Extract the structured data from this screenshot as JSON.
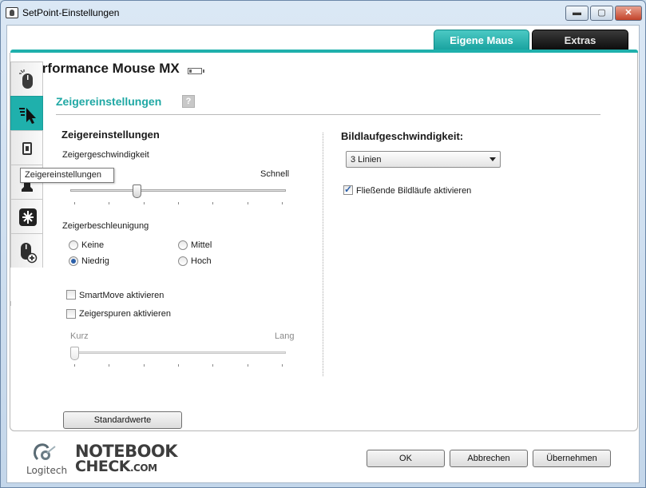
{
  "window": {
    "title": "SetPoint-Einstellungen",
    "controls": {
      "minimize": "▬",
      "maximize": "▢",
      "close": "✕"
    }
  },
  "tabs": [
    {
      "label": "Eigene Maus",
      "active": true
    },
    {
      "label": "Extras",
      "active": false
    }
  ],
  "device": {
    "name": "Performance Mouse MX"
  },
  "side_tabs": [
    {
      "icon": "mouse-buttons-icon",
      "active": false
    },
    {
      "icon": "pointer-settings-icon",
      "active": true
    },
    {
      "icon": "device-icon",
      "active": false
    },
    {
      "icon": "chess-rook-icon",
      "active": false
    },
    {
      "icon": "snowflake-icon",
      "active": false
    },
    {
      "icon": "mouse-add-icon",
      "active": false
    }
  ],
  "tooltip": "Zeigereinstellungen",
  "section": {
    "title": "Zeigereinstellungen",
    "help": "?"
  },
  "pointer": {
    "group_title": "Zeigereinstellungen",
    "speed_label": "Zeigergeschwindigkeit",
    "speed_max_label": "Schnell",
    "speed_value": 0.3,
    "accel_label": "Zeigerbeschleunigung",
    "accel_options": [
      {
        "label": "Keine",
        "checked": false
      },
      {
        "label": "Mittel",
        "checked": false
      },
      {
        "label": "Niedrig",
        "checked": true
      },
      {
        "label": "Hoch",
        "checked": false
      }
    ],
    "smartmove": {
      "label": "SmartMove aktivieren",
      "checked": false
    },
    "trails": {
      "label": "Zeigerspuren aktivieren",
      "checked": false
    },
    "trail_min_label": "Kurz",
    "trail_max_label": "Lang",
    "trail_value": 0.0
  },
  "scroll": {
    "group_title": "Bildlaufgeschwindigkeit:",
    "selected": "3 Linien",
    "smooth": {
      "label": "Fließende Bildläufe aktivieren",
      "checked": true
    }
  },
  "buttons": {
    "defaults": "Standardwerte",
    "ok": "OK",
    "cancel": "Abbrechen",
    "apply": "Übernehmen"
  },
  "footer": {
    "logitech": "Logitech",
    "notebook": "NOTEBOOK",
    "check": "CHECK",
    "com": ".COM"
  },
  "colors": {
    "accent": "#1fb0ac",
    "extras_tab": "#0d0d0d"
  }
}
